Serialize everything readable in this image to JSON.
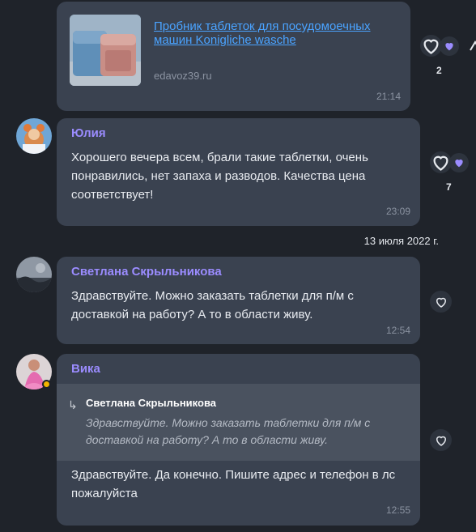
{
  "messages": [
    {
      "link_title": "Пробник таблеток для посудомоечных машин Konigliche wasche",
      "link_domain": "edavoz39.ru",
      "time": "21:14",
      "reaction_count": "2"
    },
    {
      "author": "Юлия",
      "text": "Хорошего вечера всем, брали такие таблетки, очень понравились, нет запаха и разводов. Качества цена соответствует!",
      "time": "23:09",
      "reaction_count": "7"
    },
    {
      "author": "Светлана Скрыльникова",
      "text": "Здравствуйте. Можно заказать таблетки для п/м с доставкой на работу? А то в области живу.",
      "time": "12:54"
    },
    {
      "author": "Вика",
      "quote_author": "Светлана Скрыльникова",
      "quote_text": "Здравствуйте. Можно заказать таблетки для п/м с доставкой на работу? А то в области живу.",
      "text": "Здравствуйте.  Да конечно.  Пишите адрес и телефон в лс пожалуйста",
      "time": "12:55"
    }
  ],
  "date_separator": "13 июля 2022 г.",
  "colors": {
    "background": "#1f232a",
    "bubble": "#3a4250",
    "author": "#9b8cff",
    "link": "#4aa3ff",
    "heart_filled": "#9b8cff"
  },
  "icons": [
    "heart-outline-icon",
    "heart-filled-icon",
    "reply-arrow-icon"
  ]
}
